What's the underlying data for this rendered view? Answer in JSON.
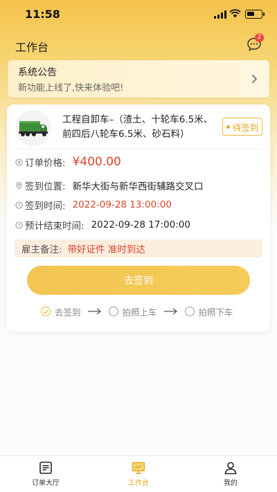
{
  "status_bar": {
    "time": "11:58"
  },
  "header": {
    "title": "工作台",
    "message_badge": "2"
  },
  "notice": {
    "title": "系统公告",
    "subtitle": "新功能上线了,快来体验吧!"
  },
  "order": {
    "vehicle_title": "工程自卸车–（渣土、十轮车6.5米、前四后八轮车6.5米、砂石料）",
    "status": "待签到",
    "price_label": "订单价格:",
    "price": "¥400.00",
    "location_label": "签到位置:",
    "location": "新华大街与新华西街辅路交叉口",
    "signin_time_label": "签到时间:",
    "signin_time": "2022-09-28 13:00:00",
    "end_time_label": "预计结束时间:",
    "end_time": "2022-09-28 17:00:00",
    "remark_label": "雇主备注:",
    "remark": "带好证件 准时到达",
    "action_label": "去签到",
    "steps": [
      "去签到",
      "拍照上车",
      "拍照下车"
    ]
  },
  "tabs": [
    {
      "label": "订单大厅",
      "icon": "order-hall-icon"
    },
    {
      "label": "工作台",
      "icon": "workbench-icon"
    },
    {
      "label": "我的",
      "icon": "profile-icon"
    }
  ],
  "colors": {
    "accent": "#f4c249",
    "price": "#d6452c",
    "tag": "#e8a823"
  }
}
